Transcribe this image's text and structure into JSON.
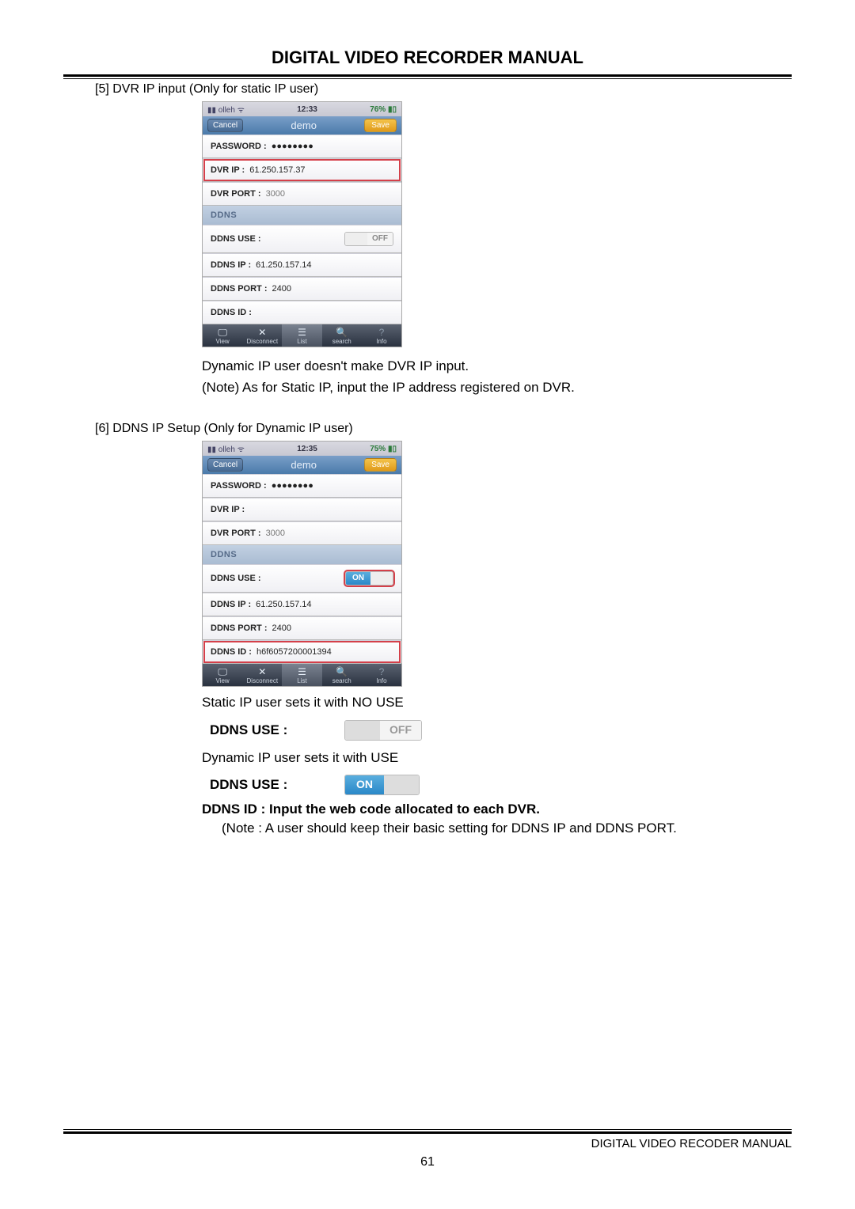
{
  "header": {
    "title": "DIGITAL VIDEO RECORDER MANUAL"
  },
  "section5": {
    "label": "[5] DVR IP input (Only for static IP user)",
    "phone": {
      "status": {
        "carrier": "olleh",
        "time": "12:33",
        "battery": "76%"
      },
      "cancel": "Cancel",
      "title": "demo",
      "save": "Save",
      "password_label": "PASSWORD :",
      "password_val": "●●●●●●●●",
      "dvrip_label": "DVR IP :",
      "dvrip_val": "61.250.157.37",
      "dvrport_label": "DVR PORT :",
      "dvrport_val": "3000",
      "ddns_header": "DDNS",
      "ddnsuse_label": "DDNS USE :",
      "ddnsuse_state": "OFF",
      "ddnsip_label": "DDNS IP :",
      "ddnsip_val": "61.250.157.14",
      "ddnsport_label": "DDNS PORT :",
      "ddnsport_val": "2400",
      "ddnsid_label": "DDNS ID :",
      "ddnsid_val": "",
      "nav": {
        "view": "View",
        "disconnect": "Disconnect",
        "list": "List",
        "search": "search",
        "info": "Info"
      }
    },
    "text1": "Dynamic IP user doesn't make DVR IP input.",
    "text2": "(Note) As for Static IP, input the IP address registered on DVR."
  },
  "section6": {
    "label": "[6] DDNS IP Setup (Only for Dynamic IP user)",
    "phone": {
      "status": {
        "carrier": "olleh",
        "time": "12:35",
        "battery": "75%"
      },
      "cancel": "Cancel",
      "title": "demo",
      "save": "Save",
      "password_label": "PASSWORD :",
      "password_val": "●●●●●●●●",
      "dvrip_label": "DVR IP :",
      "dvrip_val": "",
      "dvrport_label": "DVR PORT :",
      "dvrport_val": "3000",
      "ddns_header": "DDNS",
      "ddnsuse_label": "DDNS USE :",
      "ddnsuse_state": "ON",
      "ddnsip_label": "DDNS IP :",
      "ddnsip_val": "61.250.157.14",
      "ddnsport_label": "DDNS PORT :",
      "ddnsport_val": "2400",
      "ddnsid_label": "DDNS ID :",
      "ddnsid_val": "h6f6057200001394",
      "nav": {
        "view": "View",
        "disconnect": "Disconnect",
        "list": "List",
        "search": "search",
        "info": "Info"
      }
    },
    "text1": "Static IP user sets it with NO USE",
    "toggle_off": {
      "label": "DDNS USE :",
      "state": "OFF"
    },
    "text2": "Dynamic IP user sets it with USE",
    "toggle_on": {
      "label": "DDNS USE :",
      "state": "ON"
    },
    "bold": "DDNS ID : Input the web code allocated to each DVR.",
    "note": "(Note : A user should keep their basic setting for DDNS IP and DDNS PORT."
  },
  "footer": {
    "text": "DIGITAL VIDEO RECODER MANUAL",
    "page": "61"
  },
  "icons": {
    "wifi": "ᯤ",
    "signal": "▮▮",
    "batt": "▮▯"
  }
}
